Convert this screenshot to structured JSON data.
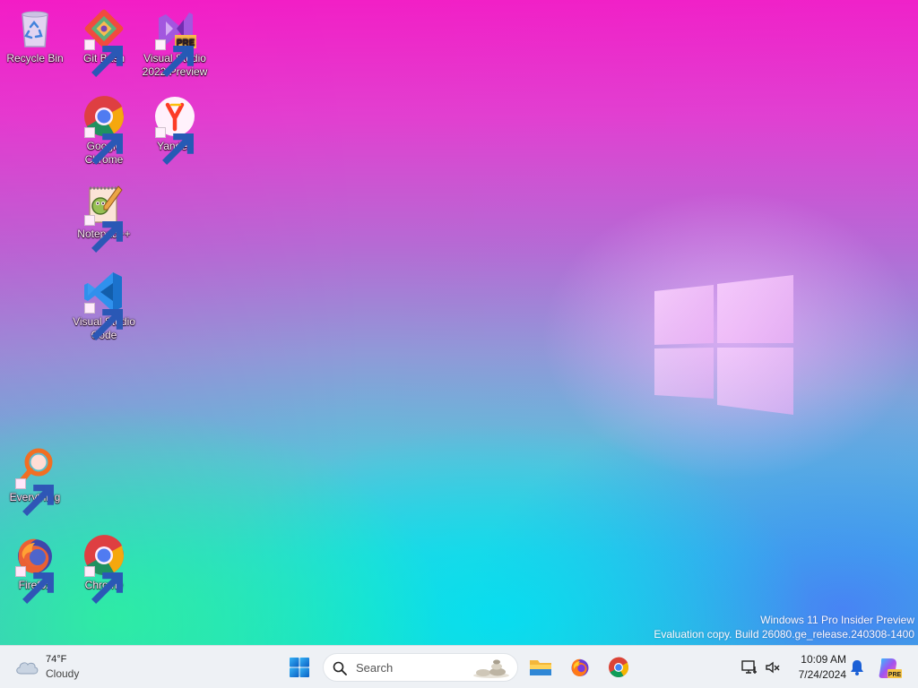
{
  "desktop": {
    "icons": [
      {
        "label": "Recycle Bin"
      },
      {
        "label": "Git Bash"
      },
      {
        "label": "Visual Studio 2022 Preview",
        "badge": "PRE"
      },
      {
        "label": "Google Chrome"
      },
      {
        "label": "Yandex"
      },
      {
        "label": "Notepad++"
      },
      {
        "label": "Visual Studio Code"
      },
      {
        "label": "Everything"
      },
      {
        "label": "Firefox"
      },
      {
        "label": "Chrome"
      }
    ],
    "watermark": {
      "line1": "Windows 11 Pro Insider Preview",
      "line2": "Evaluation copy. Build 26080.ge_release.240308-1400"
    }
  },
  "taskbar": {
    "weather": {
      "temp": "74°F",
      "condition": "Cloudy",
      "icon": "cloud-icon"
    },
    "start_icon": "windows-start-icon",
    "search": {
      "placeholder": "Search"
    },
    "pinned": [
      {
        "name": "File Explorer",
        "icon": "folder-icon"
      },
      {
        "name": "Firefox",
        "icon": "firefox-icon"
      },
      {
        "name": "Chrome",
        "icon": "chrome-icon"
      }
    ],
    "tray": {
      "time": "10:09 AM",
      "date": "7/24/2024",
      "copilot_badge": "PRE"
    }
  },
  "colors": {
    "wallpaper_top": "#f21fc6",
    "wallpaper_bottom_left": "#1effa0",
    "wallpaper_bottom_right": "#4678fa",
    "taskbar_bg": "#eef1f5",
    "windows_blue": "#0078d4"
  }
}
